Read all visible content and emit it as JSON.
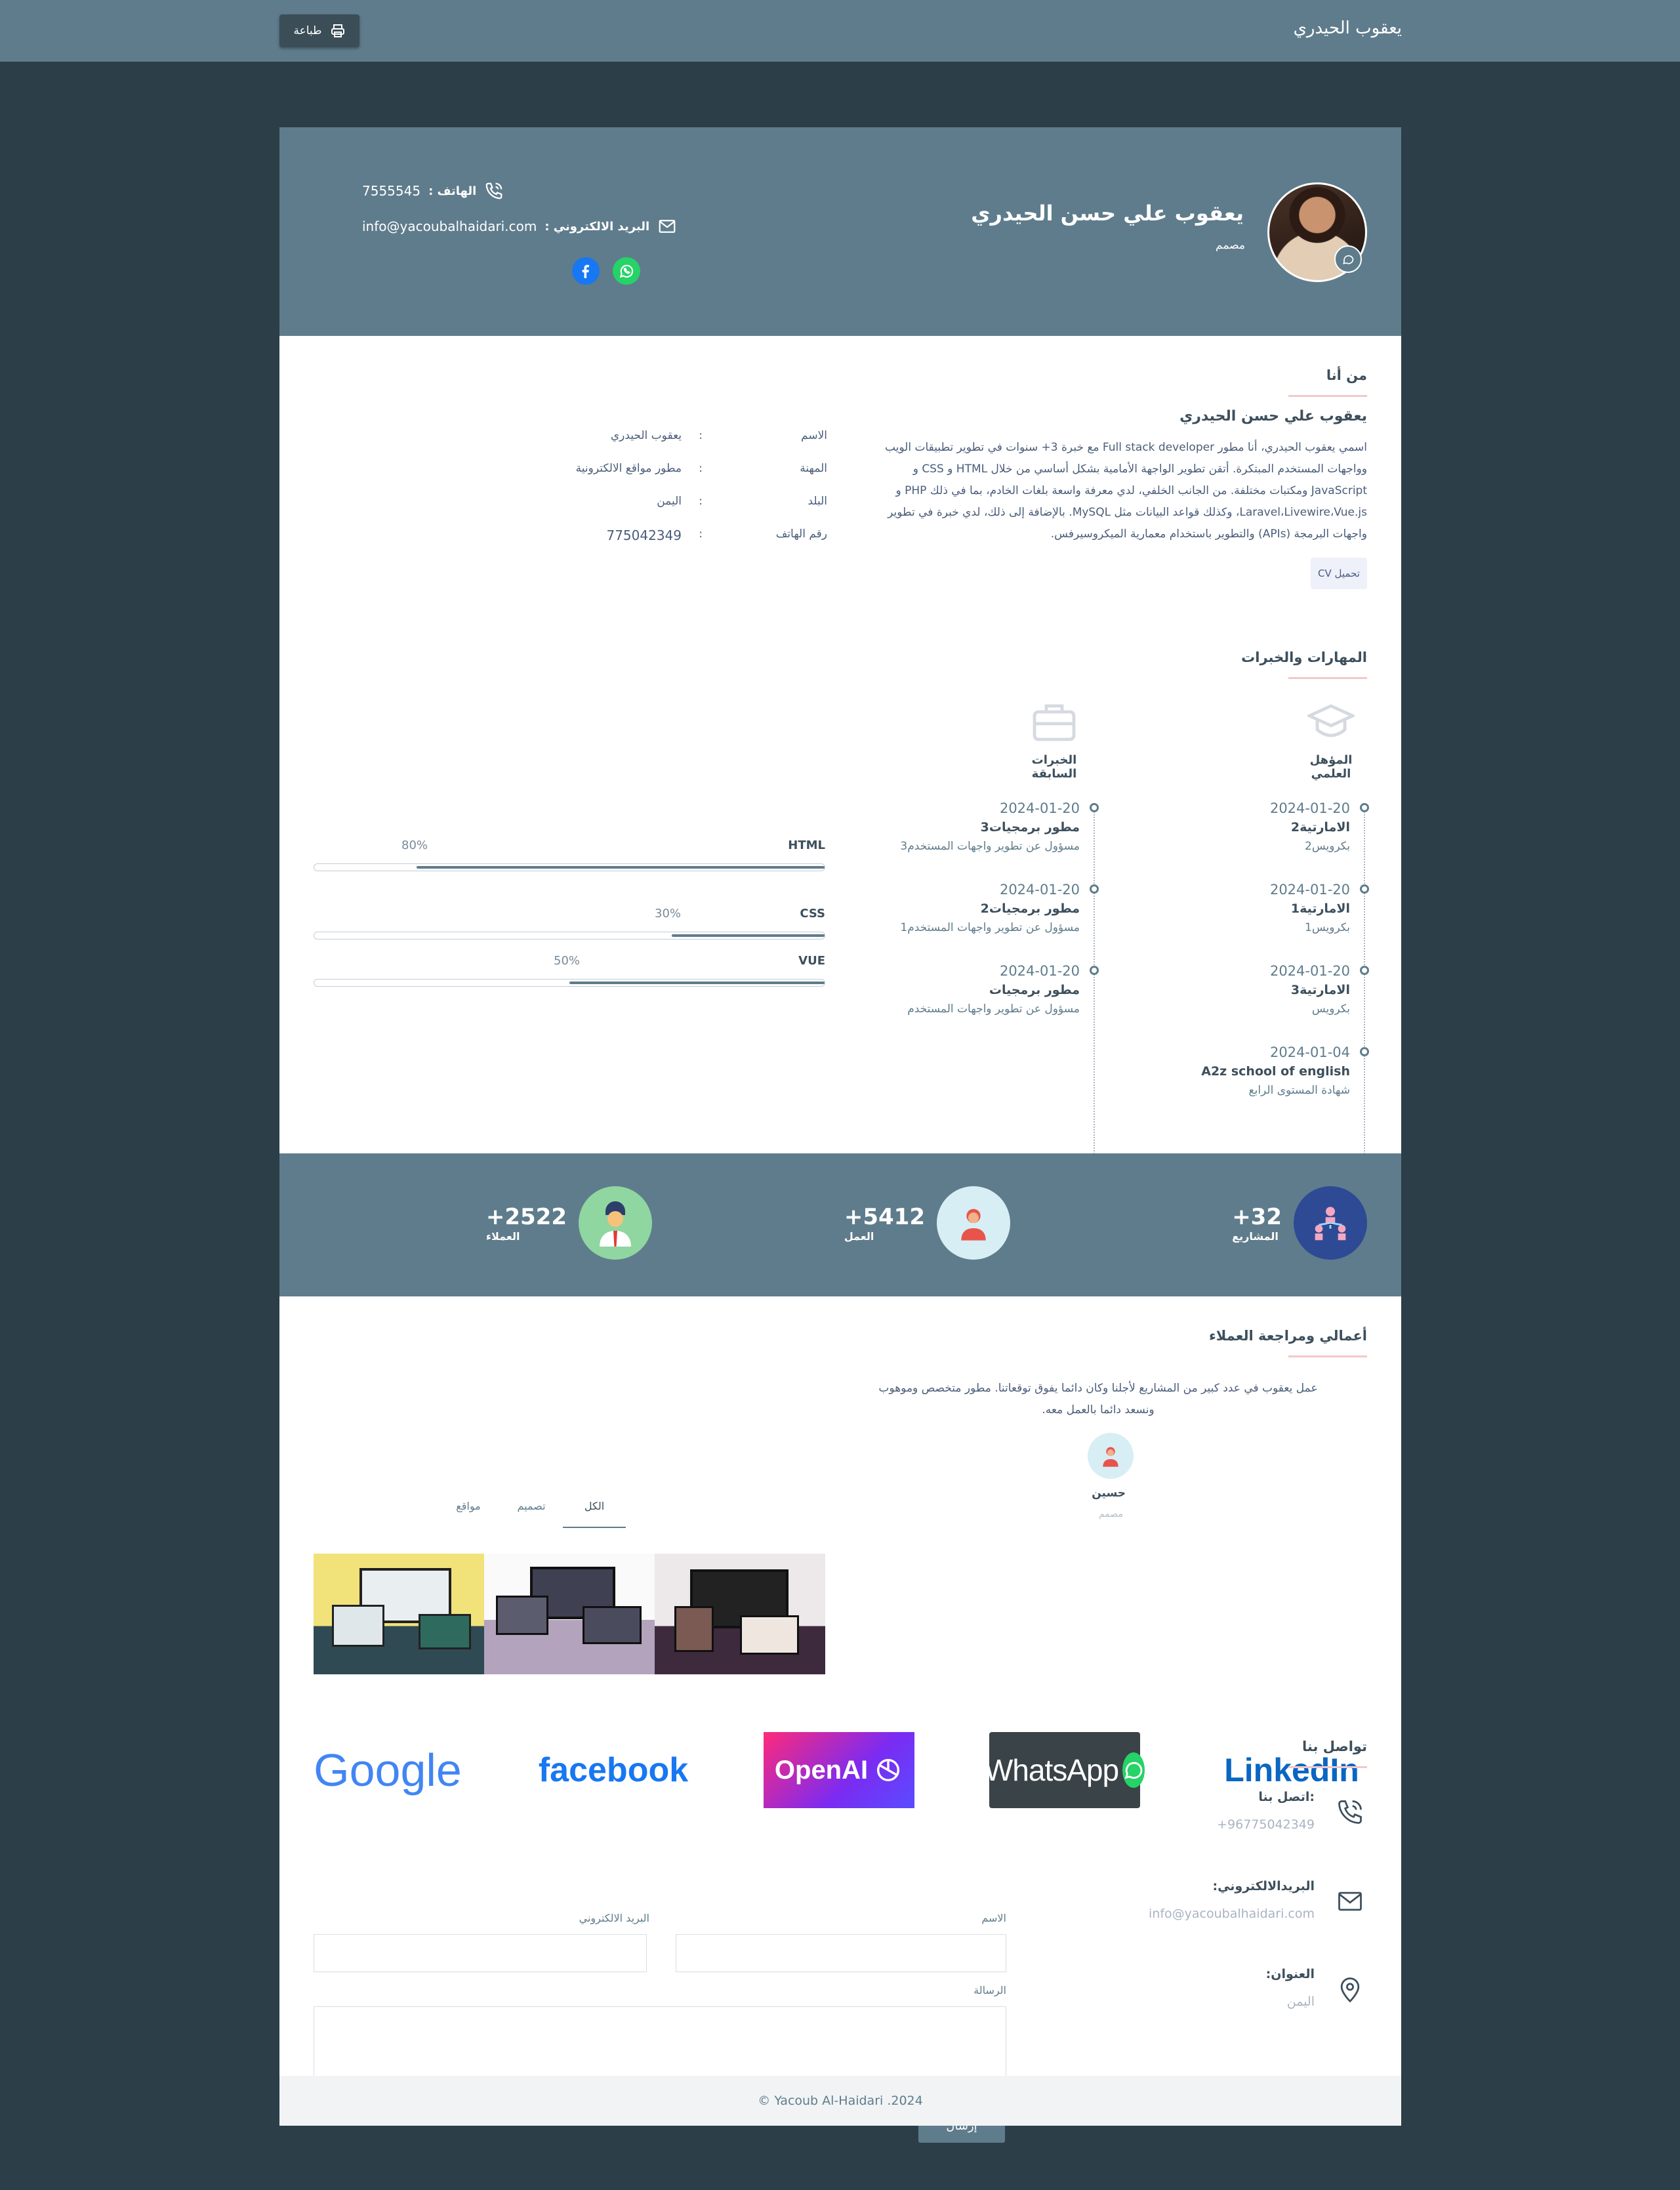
{
  "topbar": {
    "brand": "يعقوب الحيدري",
    "print_label": "طباعة"
  },
  "hero": {
    "name": "يعقوب علي حسن الحيدري",
    "role": "مصمم",
    "phone_label": "الهاتف :",
    "phone": "7555545",
    "email_label": "البريد الالكتروني :",
    "email": "info@yacoubalhaidari.com"
  },
  "about": {
    "title": "من أنا",
    "name": "يعقوب علي حسن الحيدري",
    "text": "اسمي يعقوب الحيدري، أنا مطور Full stack developer مع خبرة 3+ سنوات في تطوير تطبيقات الويب وواجهات المستخدم المبتكرة. أتقن تطوير الواجهة الأمامية بشكل أساسي من خلال HTML و CSS و JavaScript ومكتبات مختلفة. من الجانب الخلفي، لدي معرفة واسعة بلغات الخادم، بما في ذلك PHP و Laravel،Livewire،Vue.js، وكذلك قواعد البيانات مثل MySQL. بالإضافة إلى ذلك، لدي خبرة في تطوير واجهات البرمجة (APIs) والتطوير باستخدام معمارية الميكروسيرفس.",
    "cv_label": "تحميل CV",
    "info": [
      {
        "key": "الاسم",
        "value": "يعقوب الحيدري"
      },
      {
        "key": "المهنة",
        "value": "مطور مواقع الالكترونية"
      },
      {
        "key": "البلد",
        "value": "اليمن"
      },
      {
        "key": "رقم الهاتف",
        "value": "775042349"
      }
    ],
    "colon": ":"
  },
  "skills": {
    "title": "المهارات والخبرات",
    "education_head": "المؤهل العلمي",
    "experience_head": "الخبرات السابقة",
    "education": [
      {
        "date": "2024-01-20",
        "title": "الامارتية2",
        "sub": "بكرويس2"
      },
      {
        "date": "2024-01-20",
        "title": "الامارتية1",
        "sub": "بكرويس1"
      },
      {
        "date": "2024-01-20",
        "title": "الامارتية3",
        "sub": "بكرويس"
      },
      {
        "date": "2024-01-04",
        "title": "A2z school of english",
        "sub": "شهادة المستوى الرابع"
      }
    ],
    "experience": [
      {
        "date": "2024-01-20",
        "title": "مطور برمجيات3",
        "sub": "مسؤول عن تطوير واجهات المستخدم3"
      },
      {
        "date": "2024-01-20",
        "title": "مطور برمجيات2",
        "sub": "مسؤول عن تطوير واجهات المستخدم1"
      },
      {
        "date": "2024-01-20",
        "title": "مطور برمجيات",
        "sub": "مسؤول عن تطوير واجهات المستخدم"
      }
    ],
    "bars": [
      {
        "name": "HTML",
        "label": "80%",
        "value": 0.8
      },
      {
        "name": "CSS",
        "label": "30%",
        "value": 0.3
      },
      {
        "name": "VUE",
        "label": "50%",
        "value": 0.5
      }
    ]
  },
  "stats": [
    {
      "num": "+32",
      "label": "المشاريع"
    },
    {
      "num": "+5412",
      "label": "العمل"
    },
    {
      "num": "+2522",
      "label": "العملاء"
    }
  ],
  "works": {
    "title": "أعمالي ومراجعة العملاء",
    "testimonial": "عمل يعقوب في عدد كبير من المشاريع لأجلنا وكان دائما يفوق توقعاتنا. مطور متخصص وموهوب ونسعد دائما بالعمل معه.",
    "client_name": "حسين",
    "client_role": "مصمم",
    "tabs": [
      "الكل",
      "تصميم",
      "مواقع"
    ]
  },
  "logos": [
    "LinkedIn",
    "WhatsApp",
    "OpenAI",
    "facebook",
    "Google"
  ],
  "contact": {
    "title": "تواصل بنا",
    "items": [
      {
        "title": ":اتصل بنا",
        "value": "+96775042349",
        "icon": "phone-icon"
      },
      {
        "title": "البريدالالكتروني:",
        "value": "info@yacoubalhaidari.com",
        "icon": "mail-icon"
      },
      {
        "title": "العنوان:",
        "value": "اليمن",
        "icon": "location-icon"
      }
    ],
    "name_label": "الاسم",
    "email_label": "البريد الالكتروني",
    "message_label": "الرسالة",
    "send_label": "إرسال"
  },
  "footer": "Yacoub Al-Haidari .2024 ©",
  "colors": {
    "primary": "#5f7c8c",
    "dark": "#2c3e48",
    "accent_underline": "#f3c8c8"
  }
}
